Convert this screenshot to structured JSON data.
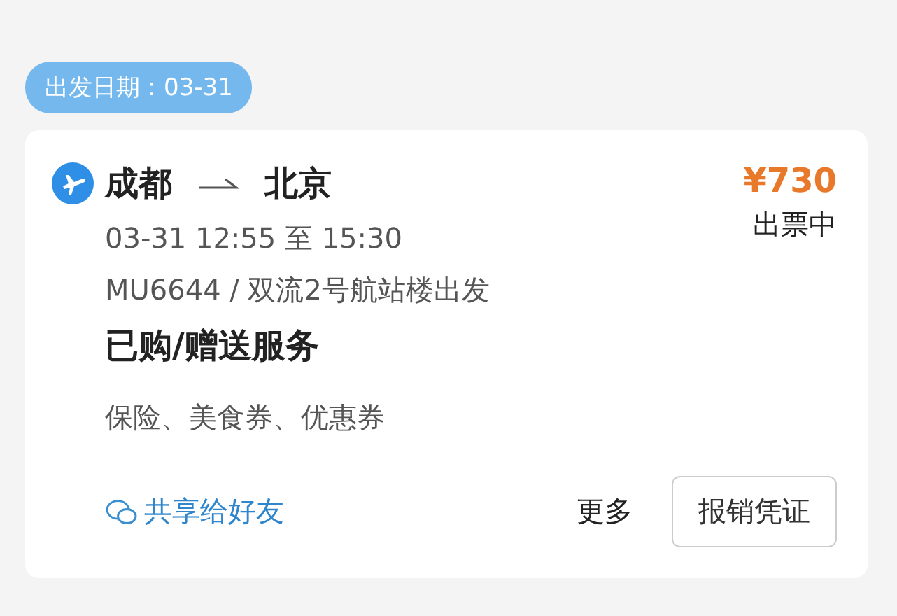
{
  "date_tag": "出发日期：03-31",
  "trip": {
    "from": "成都",
    "to": "北京",
    "price": "¥730",
    "status": "出票中",
    "time": "03-31 12:55 至 15:30",
    "flight": "MU6644 / 双流2号航站楼出发"
  },
  "services": {
    "title": "已购/赠送服务",
    "items": "保险、美食券、优惠券"
  },
  "actions": {
    "share": "共享给好友",
    "more": "更多",
    "receipt": "报销凭证"
  }
}
